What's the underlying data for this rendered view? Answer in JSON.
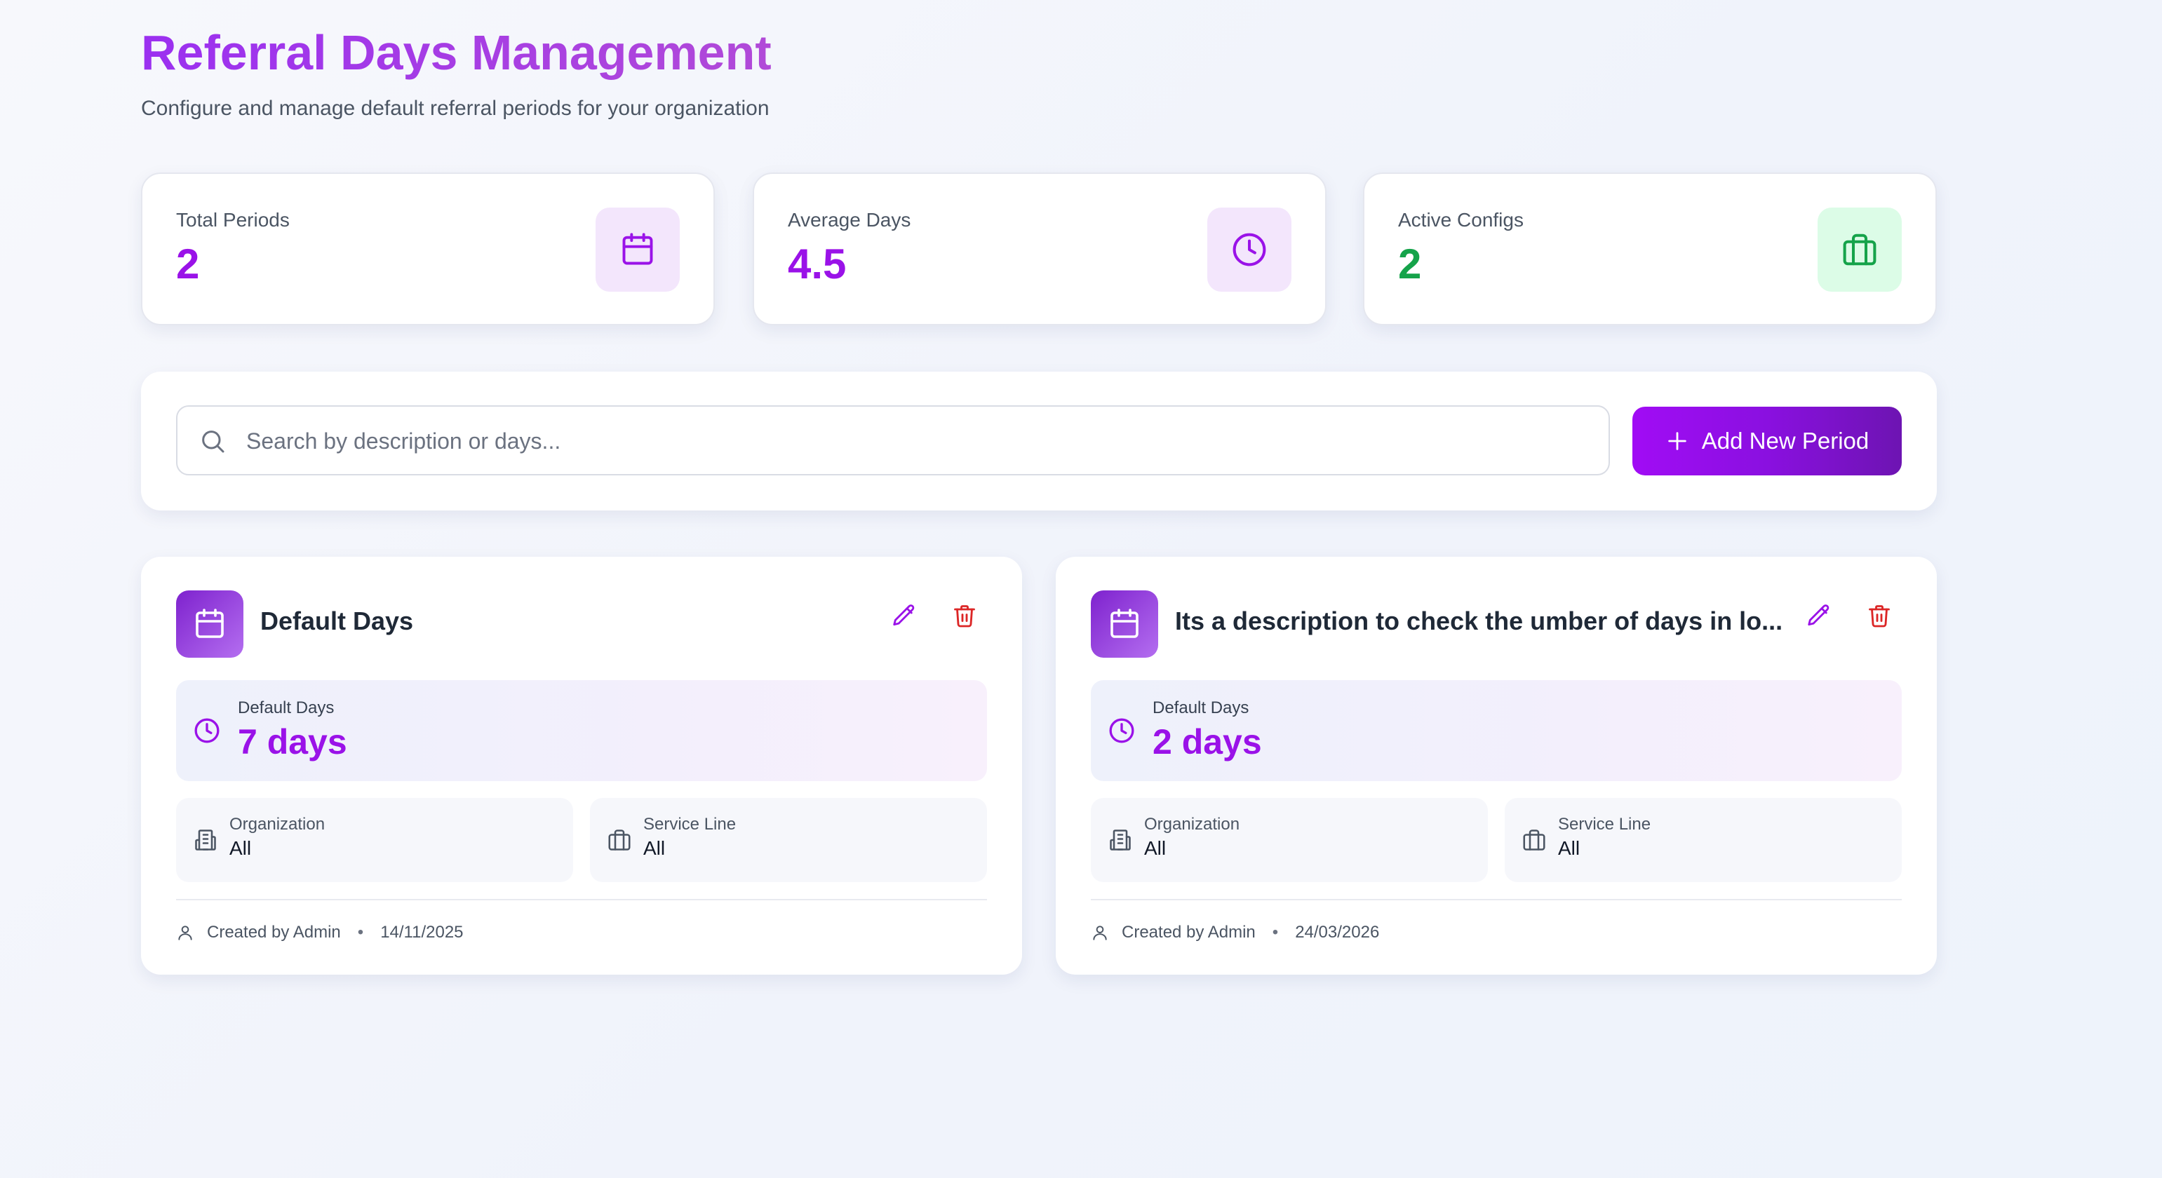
{
  "header": {
    "title": "Referral Days Management",
    "subtitle": "Configure and manage default referral periods for your organization"
  },
  "stats": [
    {
      "label": "Total Periods",
      "value": "2",
      "icon": "calendar-icon",
      "color": "#9a12e8",
      "icon_bg": "#f3e6fc"
    },
    {
      "label": "Average Days",
      "value": "4.5",
      "icon": "clock-icon",
      "color": "#9a12e8",
      "icon_bg": "#f3e6fc"
    },
    {
      "label": "Active Configs",
      "value": "2",
      "icon": "briefcase-icon",
      "color": "#15a34a",
      "icon_bg": "#dcfce7"
    }
  ],
  "toolbar": {
    "search_placeholder": "Search by description or days...",
    "search_value": "",
    "add_button_label": "Add New Period"
  },
  "periods": [
    {
      "title": "Default Days",
      "days_label": "Default Days",
      "days_value": "7 days",
      "organization_label": "Organization",
      "organization_value": "All",
      "service_line_label": "Service Line",
      "service_line_value": "All",
      "created_by": "Created by Admin",
      "date": "14/11/2025"
    },
    {
      "title": "Its a description to check the umber of days in lo...",
      "days_label": "Default Days",
      "days_value": "2 days",
      "organization_label": "Organization",
      "organization_value": "All",
      "service_line_label": "Service Line",
      "service_line_value": "All",
      "created_by": "Created by Admin",
      "date": "24/03/2026"
    }
  ],
  "colors": {
    "accent": "#9a12e8",
    "danger": "#dc2626",
    "success": "#15a34a"
  }
}
